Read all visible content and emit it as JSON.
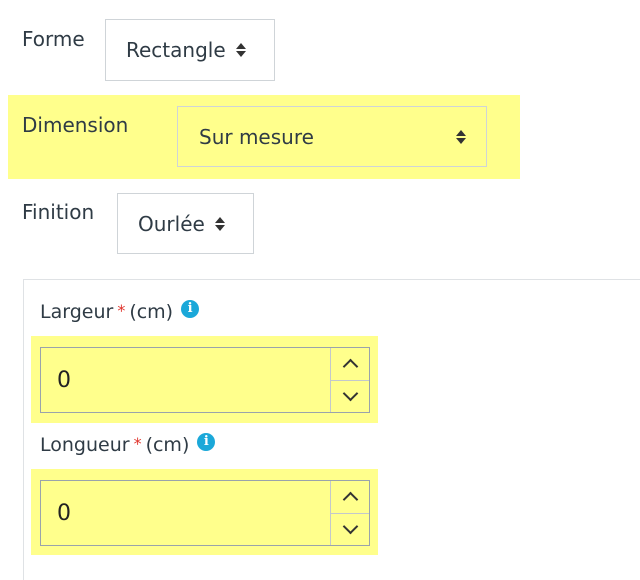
{
  "options": {
    "forme": {
      "label": "Forme",
      "value": "Rectangle"
    },
    "dimension": {
      "label": "Dimension",
      "value": "Sur mesure"
    },
    "finition": {
      "label": "Finition",
      "value": "Ourlée"
    }
  },
  "custom_size": {
    "largeur": {
      "label": "Largeur",
      "required_mark": "*",
      "unit": "(cm)",
      "value": "0"
    },
    "longueur": {
      "label": "Longueur",
      "required_mark": "*",
      "unit": "(cm)",
      "value": "0"
    }
  },
  "colors": {
    "highlight": "#ffff8c",
    "required": "#e0342c",
    "info": "#1ba8d9"
  }
}
